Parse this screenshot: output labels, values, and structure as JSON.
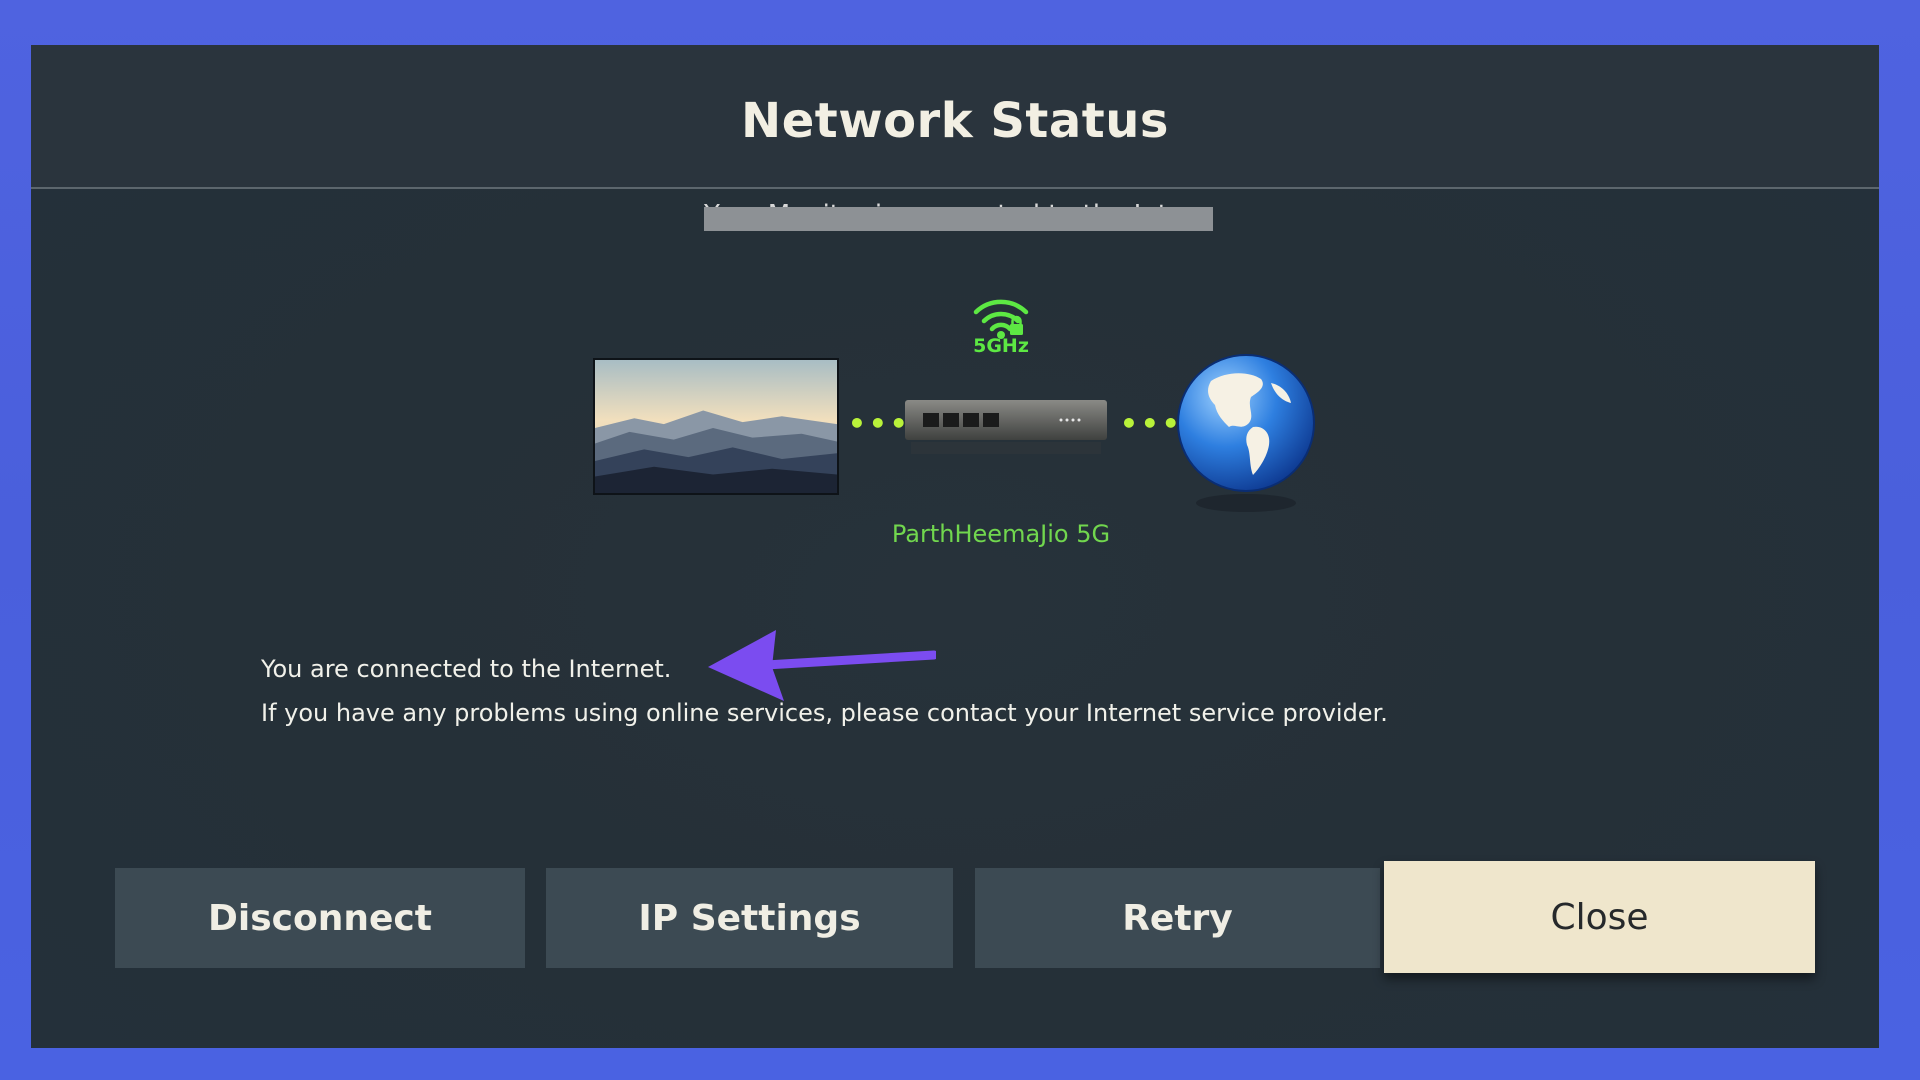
{
  "dialog": {
    "title": "Network Status",
    "redacted_subtitle": "Your Monitor is connected to the Internet."
  },
  "diagram": {
    "wifi_band": "5GHz",
    "network_name": "ParthHeemaJio 5G",
    "connection_color": "#b9f23a",
    "wifi_icon": "wifi-lock-icon",
    "router_icon": "router-icon",
    "globe_icon": "globe-icon"
  },
  "messages": {
    "line1": "You are connected to the Internet.",
    "line2": "If you have any problems using online services, please contact your Internet service provider."
  },
  "buttons": {
    "disconnect": "Disconnect",
    "ip_settings": "IP Settings",
    "retry": "Retry",
    "close": "Close"
  },
  "annotation": {
    "arrow_color": "#7b4cf0"
  }
}
